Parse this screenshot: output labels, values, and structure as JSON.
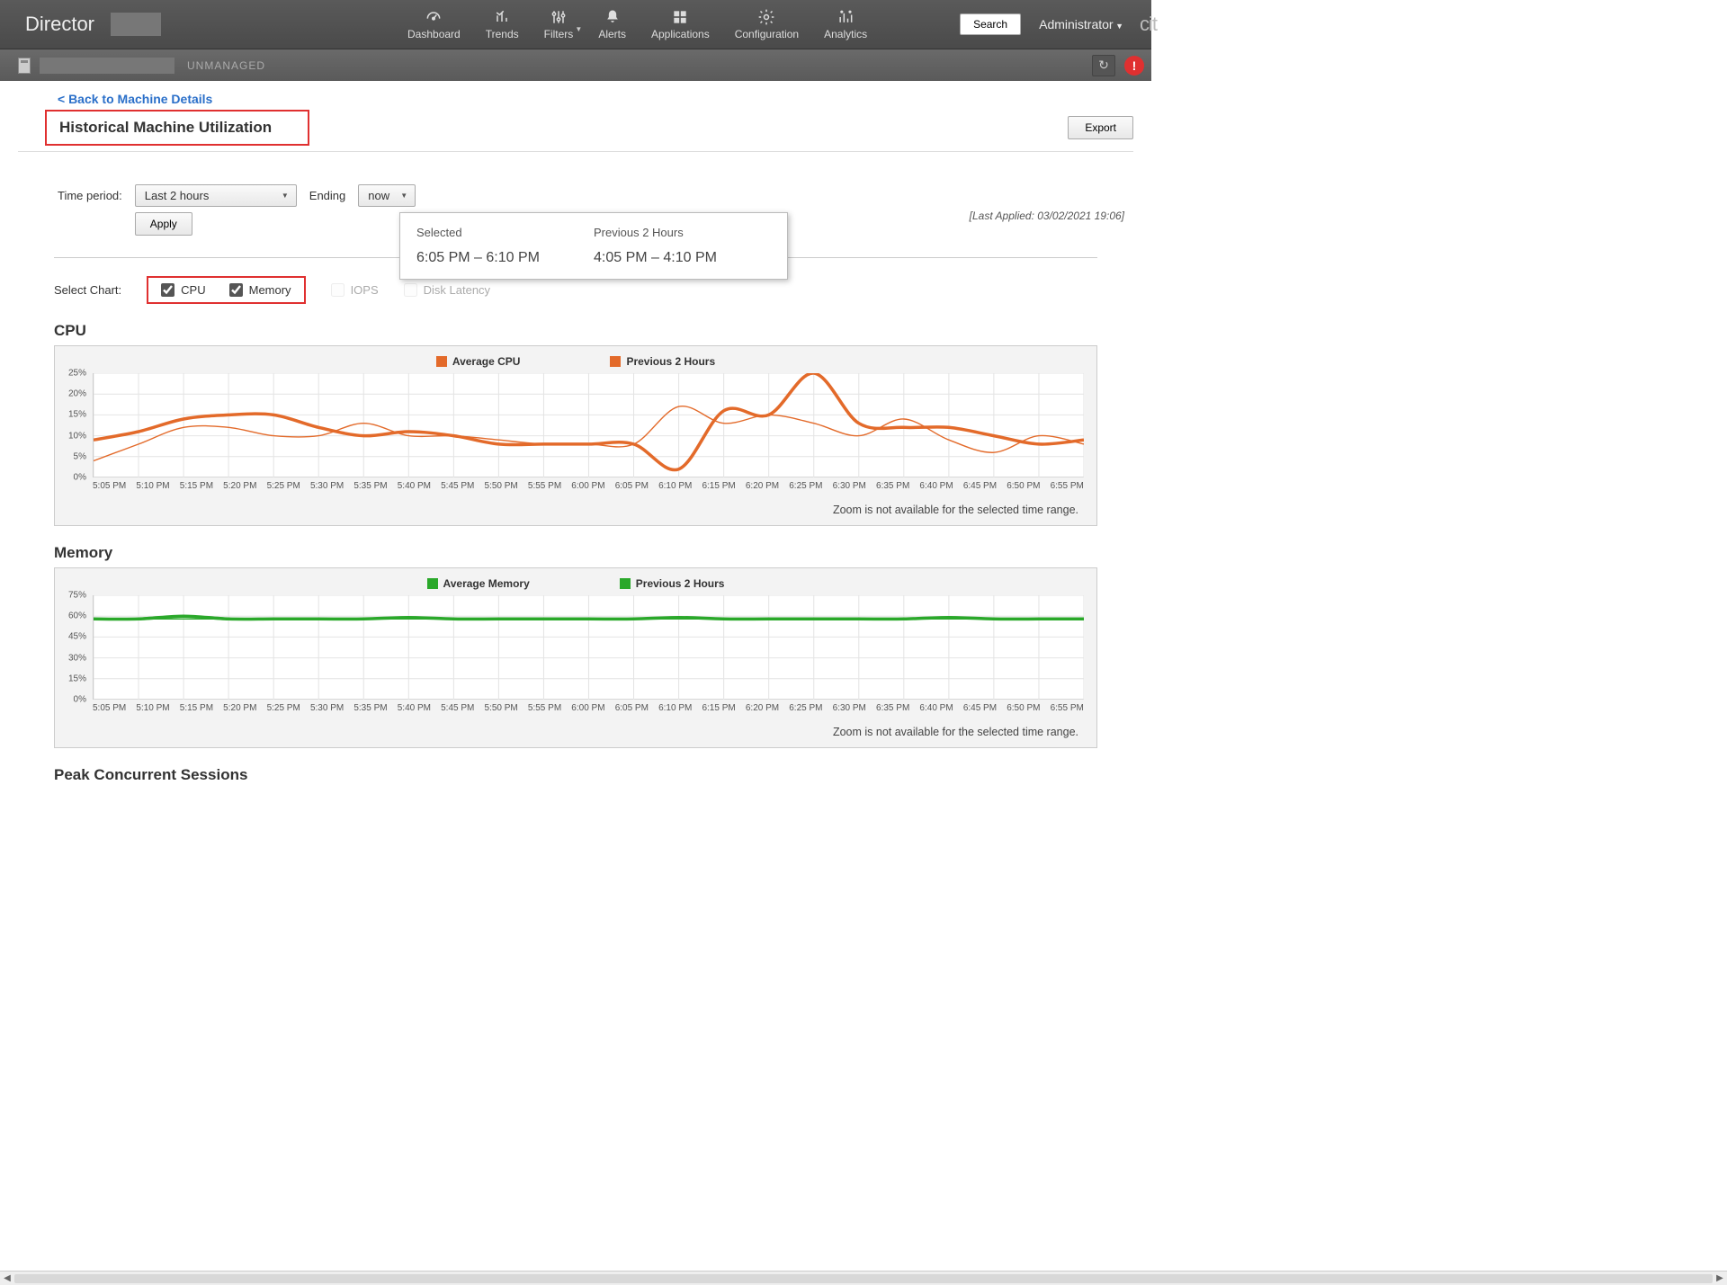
{
  "brand": "Director",
  "cobrand": "cit",
  "nav": [
    {
      "label": "Dashboard"
    },
    {
      "label": "Trends"
    },
    {
      "label": "Filters",
      "caret": true
    },
    {
      "label": "Alerts"
    },
    {
      "label": "Applications"
    },
    {
      "label": "Configuration"
    },
    {
      "label": "Analytics"
    }
  ],
  "search_label": "Search",
  "admin_label": "Administrator",
  "subbar": {
    "status": "UNMANAGED"
  },
  "backlink": "< Back to Machine Details",
  "page_title": "Historical Machine Utilization",
  "export_label": "Export",
  "filters": {
    "time_label": "Time period:",
    "time_value": "Last 2 hours",
    "ending_label": "Ending",
    "ending_value": "now",
    "apply": "Apply",
    "last_applied": "[Last Applied: 03/02/2021 19:06]"
  },
  "popup": {
    "col1_title": "Selected",
    "col1_times": "6:05 PM – 6:10 PM",
    "col2_title": "Previous 2 Hours",
    "col2_times": "4:05 PM – 4:10 PM"
  },
  "select_chart": {
    "label": "Select Chart:",
    "cpu": "CPU",
    "memory": "Memory",
    "iops": "IOPS",
    "disk": "Disk Latency"
  },
  "zoom_note": "Zoom is not available for the selected time range.",
  "peak_title": "Peak Concurrent Sessions",
  "chart_data": [
    {
      "type": "line",
      "title": "CPU",
      "ylabel": "%",
      "xlabel": "",
      "ylim": [
        0,
        25
      ],
      "yticks": [
        0,
        5,
        10,
        15,
        20,
        25
      ],
      "categories": [
        "5:05 PM",
        "5:10 PM",
        "5:15 PM",
        "5:20 PM",
        "5:25 PM",
        "5:30 PM",
        "5:35 PM",
        "5:40 PM",
        "5:45 PM",
        "5:50 PM",
        "5:55 PM",
        "6:00 PM",
        "6:05 PM",
        "6:10 PM",
        "6:15 PM",
        "6:20 PM",
        "6:25 PM",
        "6:30 PM",
        "6:35 PM",
        "6:40 PM",
        "6:45 PM",
        "6:50 PM",
        "6:55 PM"
      ],
      "series": [
        {
          "name": "Average CPU",
          "color": "#e36a2a",
          "thick": true,
          "values": [
            9,
            11,
            14,
            15,
            15,
            12,
            10,
            11,
            10,
            8,
            8,
            8,
            8,
            2,
            16,
            15,
            25,
            13,
            12,
            12,
            10,
            8,
            9
          ]
        },
        {
          "name": "Previous 2 Hours",
          "color": "#e36a2a",
          "thick": false,
          "values": [
            4,
            8,
            12,
            12,
            10,
            10,
            13,
            10,
            10,
            9,
            8,
            8,
            8,
            17,
            13,
            15,
            13,
            10,
            14,
            9,
            6,
            10,
            8
          ]
        }
      ]
    },
    {
      "type": "line",
      "title": "Memory",
      "ylabel": "%",
      "xlabel": "",
      "ylim": [
        0,
        75
      ],
      "yticks": [
        0,
        15,
        30,
        45,
        60,
        75
      ],
      "categories": [
        "5:05 PM",
        "5:10 PM",
        "5:15 PM",
        "5:20 PM",
        "5:25 PM",
        "5:30 PM",
        "5:35 PM",
        "5:40 PM",
        "5:45 PM",
        "5:50 PM",
        "5:55 PM",
        "6:00 PM",
        "6:05 PM",
        "6:10 PM",
        "6:15 PM",
        "6:20 PM",
        "6:25 PM",
        "6:30 PM",
        "6:35 PM",
        "6:40 PM",
        "6:45 PM",
        "6:50 PM",
        "6:55 PM"
      ],
      "series": [
        {
          "name": "Average Memory",
          "color": "#2aa82a",
          "thick": true,
          "values": [
            58,
            58,
            60,
            58,
            58,
            58,
            58,
            59,
            58,
            58,
            58,
            58,
            58,
            59,
            58,
            58,
            58,
            58,
            58,
            59,
            58,
            58,
            58
          ]
        },
        {
          "name": "Previous 2 Hours",
          "color": "#2aa82a",
          "thick": false,
          "values": [
            58,
            58,
            58,
            58,
            58,
            58,
            58,
            58,
            58,
            58,
            58,
            58,
            58,
            58,
            58,
            58,
            58,
            58,
            58,
            58,
            58,
            58,
            58
          ]
        }
      ]
    }
  ]
}
